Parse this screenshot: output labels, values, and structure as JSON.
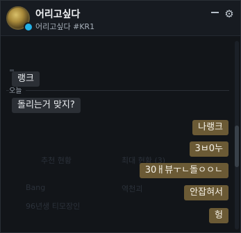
{
  "header": {
    "title": "어리고싶다",
    "subtitle": "어리고싶다 #KR1",
    "minimize_label": "",
    "settings_icon": "gear-icon",
    "presence_color": "#23b2e8"
  },
  "chat": {
    "day_separator": "오늘",
    "background_overlay": {
      "col1_header": "추천 현황",
      "col2_header": "최대 현황 (3)",
      "row1_col1": "Bang",
      "row1_col2": "역천괴",
      "row2_col1": "96년생 티모장인"
    },
    "messages": [
      {
        "side": "in",
        "text": "랭크"
      },
      {
        "side": "in",
        "text": "돌리는거 맞지?"
      },
      {
        "side": "out",
        "text": "나랭크"
      },
      {
        "side": "out",
        "text": "3ㅂ0누"
      },
      {
        "side": "out",
        "text": "30ㅐ뷰ㅜㄴ돌ㅇㅇㄴ"
      },
      {
        "side": "out",
        "text": "안잡혀서"
      },
      {
        "side": "out",
        "text": "헝"
      }
    ]
  },
  "colors": {
    "incoming_bubble": "#2b2f35",
    "outgoing_bubble": "#6b5a35",
    "background": "#121519"
  }
}
